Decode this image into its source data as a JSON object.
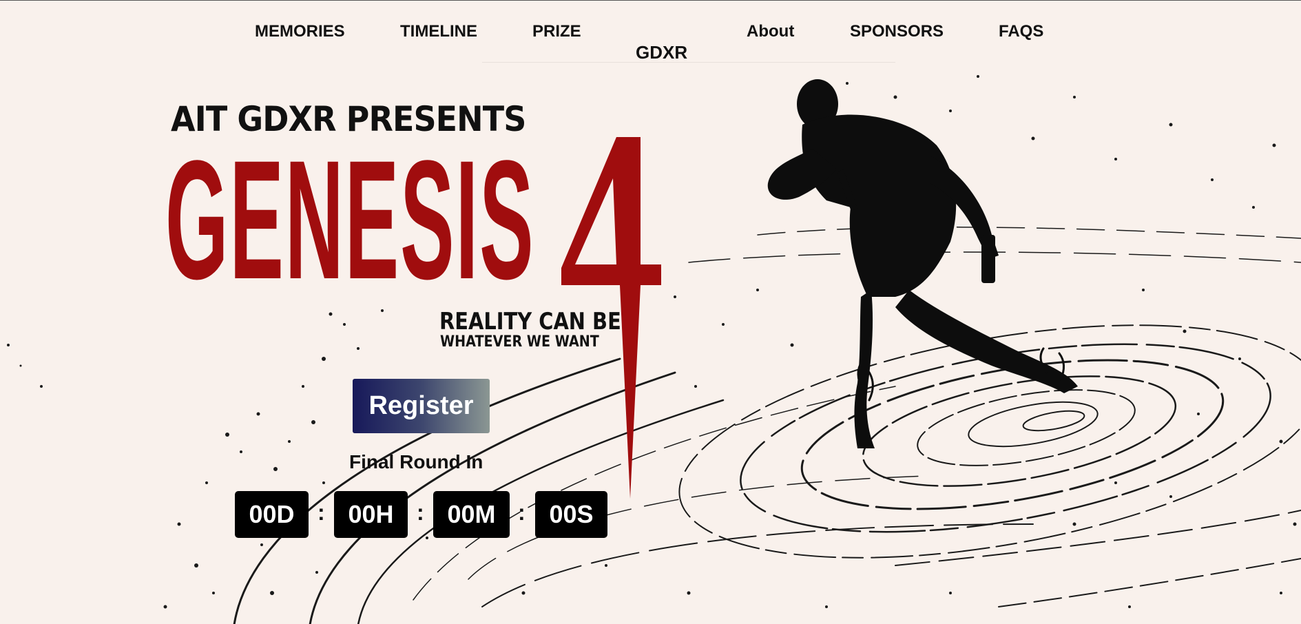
{
  "nav": {
    "items": [
      {
        "label": "MEMORIES"
      },
      {
        "label": "TIMELINE"
      },
      {
        "label": "PRIZE"
      },
      {
        "label": "GDXR"
      },
      {
        "label": "About"
      },
      {
        "label": "SPONSORS"
      },
      {
        "label": "FAQS"
      }
    ]
  },
  "hero": {
    "presents": "AIT GDXR PRESENTS",
    "title": "GENESIS",
    "title_number": "4",
    "tagline_line1": "REALITY CAN BE",
    "tagline_line2": "WHATEVER WE WANT"
  },
  "register": {
    "label": "Register"
  },
  "countdown": {
    "heading": "Final Round In",
    "days": "00D",
    "hours": "00H",
    "minutes": "00M",
    "seconds": "00S",
    "separator": ":"
  },
  "colors": {
    "background": "#f9f1ec",
    "title_red": "#a00d0e",
    "text": "#111111",
    "button_start": "#17195a",
    "button_end": "#8b9793",
    "countdown_box": "#000000"
  },
  "icons": {
    "hero_image": "running-soldier-silhouette"
  }
}
